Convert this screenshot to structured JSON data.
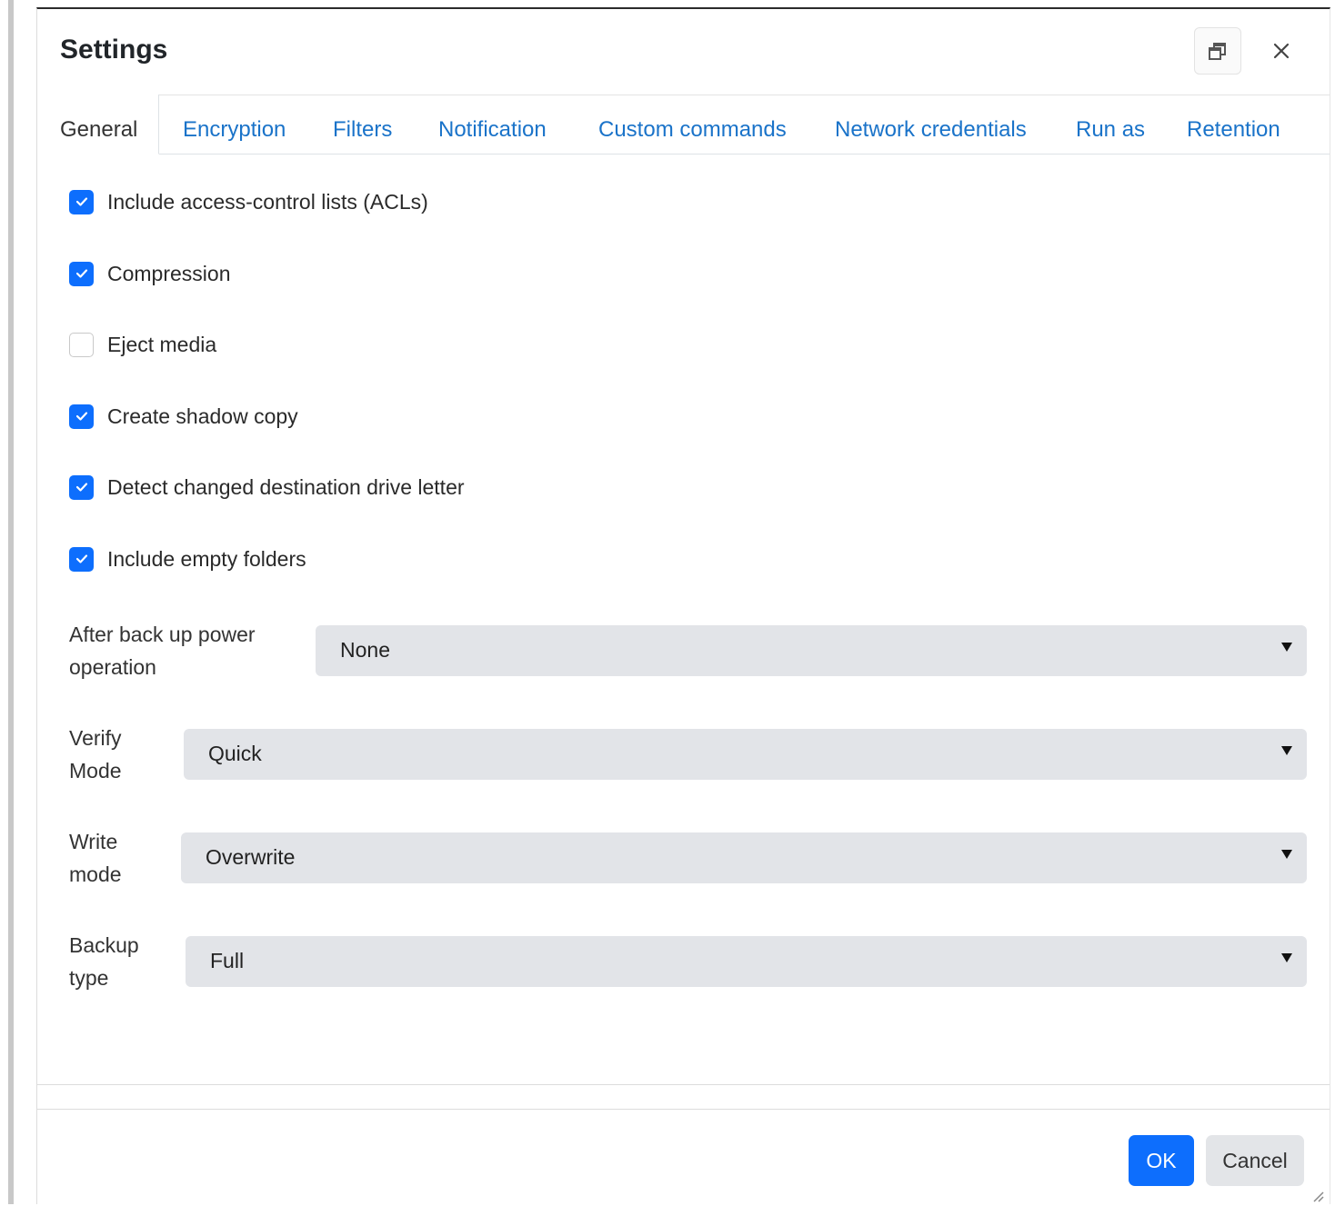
{
  "dialog": {
    "title": "Settings"
  },
  "header": {
    "restore_icon": "restore-window-icon",
    "close_icon": "close-icon",
    "close_glyph": "×"
  },
  "tabs": [
    {
      "label": "General",
      "active": true
    },
    {
      "label": "Encryption",
      "active": false
    },
    {
      "label": "Filters",
      "active": false
    },
    {
      "label": "Notification",
      "active": false
    },
    {
      "label": "Custom commands",
      "active": false
    },
    {
      "label": "Network credentials",
      "active": false
    },
    {
      "label": "Run as",
      "active": false
    },
    {
      "label": "Retention",
      "active": false
    }
  ],
  "options": [
    {
      "label": "Include access-control lists (ACLs)",
      "checked": true
    },
    {
      "label": "Compression",
      "checked": true
    },
    {
      "label": "Eject media",
      "checked": false
    },
    {
      "label": "Create shadow copy",
      "checked": true
    },
    {
      "label": "Detect changed destination drive letter",
      "checked": true
    },
    {
      "label": "Include empty folders",
      "checked": true
    }
  ],
  "fields": {
    "power": {
      "label_line1": "After back up power",
      "label_line2": "operation",
      "value": "None"
    },
    "verify": {
      "label_line1": "Verify",
      "label_line2": "Mode",
      "value": "Quick"
    },
    "write": {
      "label_line1": "Write",
      "label_line2": "mode",
      "value": "Overwrite"
    },
    "backup": {
      "label_line1": "Backup",
      "label_line2": "type",
      "value": "Full"
    }
  },
  "footer": {
    "ok_label": "OK",
    "cancel_label": "Cancel"
  },
  "colors": {
    "accent": "#0d6efd",
    "tab_link": "#1a73c9",
    "select_bg": "#e2e4e8"
  }
}
